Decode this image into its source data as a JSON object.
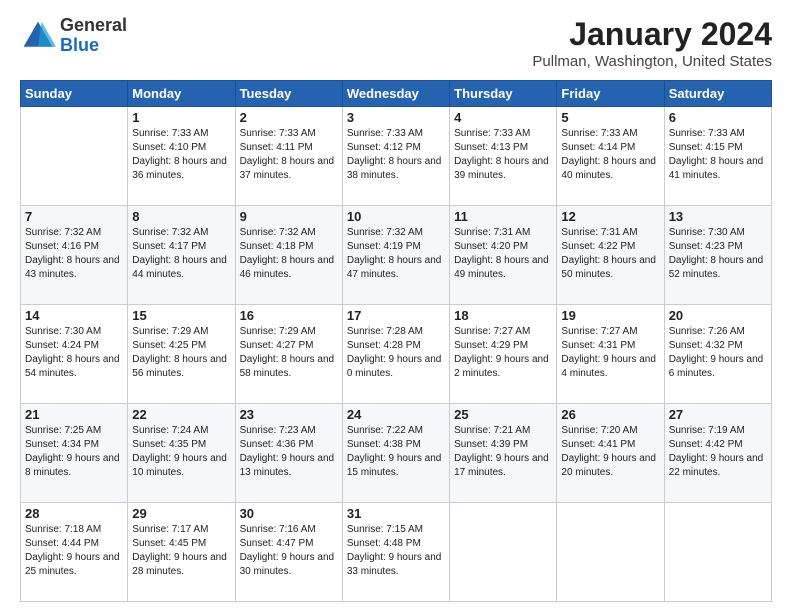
{
  "header": {
    "logo_general": "General",
    "logo_blue": "Blue",
    "month_title": "January 2024",
    "location": "Pullman, Washington, United States"
  },
  "days_of_week": [
    "Sunday",
    "Monday",
    "Tuesday",
    "Wednesday",
    "Thursday",
    "Friday",
    "Saturday"
  ],
  "weeks": [
    [
      {
        "day": "",
        "sunrise": "",
        "sunset": "",
        "daylight": ""
      },
      {
        "day": "1",
        "sunrise": "Sunrise: 7:33 AM",
        "sunset": "Sunset: 4:10 PM",
        "daylight": "Daylight: 8 hours and 36 minutes."
      },
      {
        "day": "2",
        "sunrise": "Sunrise: 7:33 AM",
        "sunset": "Sunset: 4:11 PM",
        "daylight": "Daylight: 8 hours and 37 minutes."
      },
      {
        "day": "3",
        "sunrise": "Sunrise: 7:33 AM",
        "sunset": "Sunset: 4:12 PM",
        "daylight": "Daylight: 8 hours and 38 minutes."
      },
      {
        "day": "4",
        "sunrise": "Sunrise: 7:33 AM",
        "sunset": "Sunset: 4:13 PM",
        "daylight": "Daylight: 8 hours and 39 minutes."
      },
      {
        "day": "5",
        "sunrise": "Sunrise: 7:33 AM",
        "sunset": "Sunset: 4:14 PM",
        "daylight": "Daylight: 8 hours and 40 minutes."
      },
      {
        "day": "6",
        "sunrise": "Sunrise: 7:33 AM",
        "sunset": "Sunset: 4:15 PM",
        "daylight": "Daylight: 8 hours and 41 minutes."
      }
    ],
    [
      {
        "day": "7",
        "sunrise": "Sunrise: 7:32 AM",
        "sunset": "Sunset: 4:16 PM",
        "daylight": "Daylight: 8 hours and 43 minutes."
      },
      {
        "day": "8",
        "sunrise": "Sunrise: 7:32 AM",
        "sunset": "Sunset: 4:17 PM",
        "daylight": "Daylight: 8 hours and 44 minutes."
      },
      {
        "day": "9",
        "sunrise": "Sunrise: 7:32 AM",
        "sunset": "Sunset: 4:18 PM",
        "daylight": "Daylight: 8 hours and 46 minutes."
      },
      {
        "day": "10",
        "sunrise": "Sunrise: 7:32 AM",
        "sunset": "Sunset: 4:19 PM",
        "daylight": "Daylight: 8 hours and 47 minutes."
      },
      {
        "day": "11",
        "sunrise": "Sunrise: 7:31 AM",
        "sunset": "Sunset: 4:20 PM",
        "daylight": "Daylight: 8 hours and 49 minutes."
      },
      {
        "day": "12",
        "sunrise": "Sunrise: 7:31 AM",
        "sunset": "Sunset: 4:22 PM",
        "daylight": "Daylight: 8 hours and 50 minutes."
      },
      {
        "day": "13",
        "sunrise": "Sunrise: 7:30 AM",
        "sunset": "Sunset: 4:23 PM",
        "daylight": "Daylight: 8 hours and 52 minutes."
      }
    ],
    [
      {
        "day": "14",
        "sunrise": "Sunrise: 7:30 AM",
        "sunset": "Sunset: 4:24 PM",
        "daylight": "Daylight: 8 hours and 54 minutes."
      },
      {
        "day": "15",
        "sunrise": "Sunrise: 7:29 AM",
        "sunset": "Sunset: 4:25 PM",
        "daylight": "Daylight: 8 hours and 56 minutes."
      },
      {
        "day": "16",
        "sunrise": "Sunrise: 7:29 AM",
        "sunset": "Sunset: 4:27 PM",
        "daylight": "Daylight: 8 hours and 58 minutes."
      },
      {
        "day": "17",
        "sunrise": "Sunrise: 7:28 AM",
        "sunset": "Sunset: 4:28 PM",
        "daylight": "Daylight: 9 hours and 0 minutes."
      },
      {
        "day": "18",
        "sunrise": "Sunrise: 7:27 AM",
        "sunset": "Sunset: 4:29 PM",
        "daylight": "Daylight: 9 hours and 2 minutes."
      },
      {
        "day": "19",
        "sunrise": "Sunrise: 7:27 AM",
        "sunset": "Sunset: 4:31 PM",
        "daylight": "Daylight: 9 hours and 4 minutes."
      },
      {
        "day": "20",
        "sunrise": "Sunrise: 7:26 AM",
        "sunset": "Sunset: 4:32 PM",
        "daylight": "Daylight: 9 hours and 6 minutes."
      }
    ],
    [
      {
        "day": "21",
        "sunrise": "Sunrise: 7:25 AM",
        "sunset": "Sunset: 4:34 PM",
        "daylight": "Daylight: 9 hours and 8 minutes."
      },
      {
        "day": "22",
        "sunrise": "Sunrise: 7:24 AM",
        "sunset": "Sunset: 4:35 PM",
        "daylight": "Daylight: 9 hours and 10 minutes."
      },
      {
        "day": "23",
        "sunrise": "Sunrise: 7:23 AM",
        "sunset": "Sunset: 4:36 PM",
        "daylight": "Daylight: 9 hours and 13 minutes."
      },
      {
        "day": "24",
        "sunrise": "Sunrise: 7:22 AM",
        "sunset": "Sunset: 4:38 PM",
        "daylight": "Daylight: 9 hours and 15 minutes."
      },
      {
        "day": "25",
        "sunrise": "Sunrise: 7:21 AM",
        "sunset": "Sunset: 4:39 PM",
        "daylight": "Daylight: 9 hours and 17 minutes."
      },
      {
        "day": "26",
        "sunrise": "Sunrise: 7:20 AM",
        "sunset": "Sunset: 4:41 PM",
        "daylight": "Daylight: 9 hours and 20 minutes."
      },
      {
        "day": "27",
        "sunrise": "Sunrise: 7:19 AM",
        "sunset": "Sunset: 4:42 PM",
        "daylight": "Daylight: 9 hours and 22 minutes."
      }
    ],
    [
      {
        "day": "28",
        "sunrise": "Sunrise: 7:18 AM",
        "sunset": "Sunset: 4:44 PM",
        "daylight": "Daylight: 9 hours and 25 minutes."
      },
      {
        "day": "29",
        "sunrise": "Sunrise: 7:17 AM",
        "sunset": "Sunset: 4:45 PM",
        "daylight": "Daylight: 9 hours and 28 minutes."
      },
      {
        "day": "30",
        "sunrise": "Sunrise: 7:16 AM",
        "sunset": "Sunset: 4:47 PM",
        "daylight": "Daylight: 9 hours and 30 minutes."
      },
      {
        "day": "31",
        "sunrise": "Sunrise: 7:15 AM",
        "sunset": "Sunset: 4:48 PM",
        "daylight": "Daylight: 9 hours and 33 minutes."
      },
      {
        "day": "",
        "sunrise": "",
        "sunset": "",
        "daylight": ""
      },
      {
        "day": "",
        "sunrise": "",
        "sunset": "",
        "daylight": ""
      },
      {
        "day": "",
        "sunrise": "",
        "sunset": "",
        "daylight": ""
      }
    ]
  ]
}
